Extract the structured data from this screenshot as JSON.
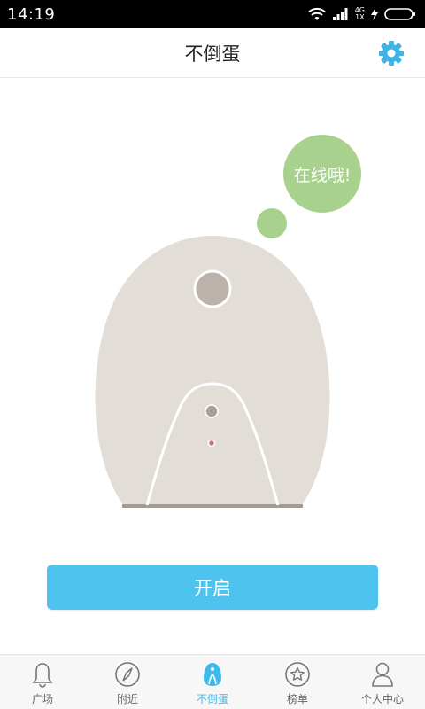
{
  "status_bar": {
    "time": "14:19",
    "network_top": "4G",
    "network_bottom": "1X"
  },
  "header": {
    "title": "不倒蛋",
    "settings_icon": "gear-icon"
  },
  "device": {
    "status_bubble_text": "在线哦!",
    "bubble_color": "#a9d18e",
    "body_color": "#e3ddd8"
  },
  "action": {
    "open_button_label": "开启",
    "button_color": "#4ec3ef"
  },
  "tabs": [
    {
      "label": "广场",
      "icon": "bell-icon",
      "active": false
    },
    {
      "label": "附近",
      "icon": "compass-icon",
      "active": false
    },
    {
      "label": "不倒蛋",
      "icon": "egg-icon",
      "active": true
    },
    {
      "label": "榜单",
      "icon": "star-icon",
      "active": false
    },
    {
      "label": "个人中心",
      "icon": "person-icon",
      "active": false
    }
  ],
  "colors": {
    "accent": "#3fb9ea",
    "inactive_tab": "#666666"
  }
}
